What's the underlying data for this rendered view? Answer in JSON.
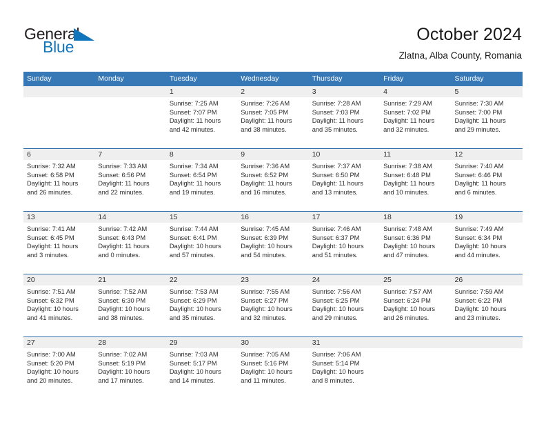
{
  "brand": {
    "name_part1": "General",
    "name_part2": "Blue",
    "triangle_icon": "blue-triangle-icon",
    "color_dark": "#231f20",
    "color_blue": "#1175bc"
  },
  "header": {
    "title": "October 2024",
    "subtitle": "Zlatna, Alba County, Romania"
  },
  "theme": {
    "header_bg": "#3778b7",
    "row_divider": "#2b6cab",
    "date_band_bg": "#efefef",
    "text": "#2b2b2b"
  },
  "weekdays": [
    "Sunday",
    "Monday",
    "Tuesday",
    "Wednesday",
    "Thursday",
    "Friday",
    "Saturday"
  ],
  "labels": {
    "sunrise_prefix": "Sunrise: ",
    "sunset_prefix": "Sunset: ",
    "daylight_prefix": "Daylight: "
  },
  "weeks": [
    {
      "days": [
        {
          "day": "",
          "empty": true
        },
        {
          "day": "",
          "empty": true
        },
        {
          "day": "1",
          "sunrise": "Sunrise: 7:25 AM",
          "sunset": "Sunset: 7:07 PM",
          "daylight1": "Daylight: 11 hours",
          "daylight2": "and 42 minutes."
        },
        {
          "day": "2",
          "sunrise": "Sunrise: 7:26 AM",
          "sunset": "Sunset: 7:05 PM",
          "daylight1": "Daylight: 11 hours",
          "daylight2": "and 38 minutes."
        },
        {
          "day": "3",
          "sunrise": "Sunrise: 7:28 AM",
          "sunset": "Sunset: 7:03 PM",
          "daylight1": "Daylight: 11 hours",
          "daylight2": "and 35 minutes."
        },
        {
          "day": "4",
          "sunrise": "Sunrise: 7:29 AM",
          "sunset": "Sunset: 7:02 PM",
          "daylight1": "Daylight: 11 hours",
          "daylight2": "and 32 minutes."
        },
        {
          "day": "5",
          "sunrise": "Sunrise: 7:30 AM",
          "sunset": "Sunset: 7:00 PM",
          "daylight1": "Daylight: 11 hours",
          "daylight2": "and 29 minutes."
        }
      ]
    },
    {
      "days": [
        {
          "day": "6",
          "sunrise": "Sunrise: 7:32 AM",
          "sunset": "Sunset: 6:58 PM",
          "daylight1": "Daylight: 11 hours",
          "daylight2": "and 26 minutes."
        },
        {
          "day": "7",
          "sunrise": "Sunrise: 7:33 AM",
          "sunset": "Sunset: 6:56 PM",
          "daylight1": "Daylight: 11 hours",
          "daylight2": "and 22 minutes."
        },
        {
          "day": "8",
          "sunrise": "Sunrise: 7:34 AM",
          "sunset": "Sunset: 6:54 PM",
          "daylight1": "Daylight: 11 hours",
          "daylight2": "and 19 minutes."
        },
        {
          "day": "9",
          "sunrise": "Sunrise: 7:36 AM",
          "sunset": "Sunset: 6:52 PM",
          "daylight1": "Daylight: 11 hours",
          "daylight2": "and 16 minutes."
        },
        {
          "day": "10",
          "sunrise": "Sunrise: 7:37 AM",
          "sunset": "Sunset: 6:50 PM",
          "daylight1": "Daylight: 11 hours",
          "daylight2": "and 13 minutes."
        },
        {
          "day": "11",
          "sunrise": "Sunrise: 7:38 AM",
          "sunset": "Sunset: 6:48 PM",
          "daylight1": "Daylight: 11 hours",
          "daylight2": "and 10 minutes."
        },
        {
          "day": "12",
          "sunrise": "Sunrise: 7:40 AM",
          "sunset": "Sunset: 6:46 PM",
          "daylight1": "Daylight: 11 hours",
          "daylight2": "and 6 minutes."
        }
      ]
    },
    {
      "days": [
        {
          "day": "13",
          "sunrise": "Sunrise: 7:41 AM",
          "sunset": "Sunset: 6:45 PM",
          "daylight1": "Daylight: 11 hours",
          "daylight2": "and 3 minutes."
        },
        {
          "day": "14",
          "sunrise": "Sunrise: 7:42 AM",
          "sunset": "Sunset: 6:43 PM",
          "daylight1": "Daylight: 11 hours",
          "daylight2": "and 0 minutes."
        },
        {
          "day": "15",
          "sunrise": "Sunrise: 7:44 AM",
          "sunset": "Sunset: 6:41 PM",
          "daylight1": "Daylight: 10 hours",
          "daylight2": "and 57 minutes."
        },
        {
          "day": "16",
          "sunrise": "Sunrise: 7:45 AM",
          "sunset": "Sunset: 6:39 PM",
          "daylight1": "Daylight: 10 hours",
          "daylight2": "and 54 minutes."
        },
        {
          "day": "17",
          "sunrise": "Sunrise: 7:46 AM",
          "sunset": "Sunset: 6:37 PM",
          "daylight1": "Daylight: 10 hours",
          "daylight2": "and 51 minutes."
        },
        {
          "day": "18",
          "sunrise": "Sunrise: 7:48 AM",
          "sunset": "Sunset: 6:36 PM",
          "daylight1": "Daylight: 10 hours",
          "daylight2": "and 47 minutes."
        },
        {
          "day": "19",
          "sunrise": "Sunrise: 7:49 AM",
          "sunset": "Sunset: 6:34 PM",
          "daylight1": "Daylight: 10 hours",
          "daylight2": "and 44 minutes."
        }
      ]
    },
    {
      "days": [
        {
          "day": "20",
          "sunrise": "Sunrise: 7:51 AM",
          "sunset": "Sunset: 6:32 PM",
          "daylight1": "Daylight: 10 hours",
          "daylight2": "and 41 minutes."
        },
        {
          "day": "21",
          "sunrise": "Sunrise: 7:52 AM",
          "sunset": "Sunset: 6:30 PM",
          "daylight1": "Daylight: 10 hours",
          "daylight2": "and 38 minutes."
        },
        {
          "day": "22",
          "sunrise": "Sunrise: 7:53 AM",
          "sunset": "Sunset: 6:29 PM",
          "daylight1": "Daylight: 10 hours",
          "daylight2": "and 35 minutes."
        },
        {
          "day": "23",
          "sunrise": "Sunrise: 7:55 AM",
          "sunset": "Sunset: 6:27 PM",
          "daylight1": "Daylight: 10 hours",
          "daylight2": "and 32 minutes."
        },
        {
          "day": "24",
          "sunrise": "Sunrise: 7:56 AM",
          "sunset": "Sunset: 6:25 PM",
          "daylight1": "Daylight: 10 hours",
          "daylight2": "and 29 minutes."
        },
        {
          "day": "25",
          "sunrise": "Sunrise: 7:57 AM",
          "sunset": "Sunset: 6:24 PM",
          "daylight1": "Daylight: 10 hours",
          "daylight2": "and 26 minutes."
        },
        {
          "day": "26",
          "sunrise": "Sunrise: 7:59 AM",
          "sunset": "Sunset: 6:22 PM",
          "daylight1": "Daylight: 10 hours",
          "daylight2": "and 23 minutes."
        }
      ]
    },
    {
      "days": [
        {
          "day": "27",
          "sunrise": "Sunrise: 7:00 AM",
          "sunset": "Sunset: 5:20 PM",
          "daylight1": "Daylight: 10 hours",
          "daylight2": "and 20 minutes."
        },
        {
          "day": "28",
          "sunrise": "Sunrise: 7:02 AM",
          "sunset": "Sunset: 5:19 PM",
          "daylight1": "Daylight: 10 hours",
          "daylight2": "and 17 minutes."
        },
        {
          "day": "29",
          "sunrise": "Sunrise: 7:03 AM",
          "sunset": "Sunset: 5:17 PM",
          "daylight1": "Daylight: 10 hours",
          "daylight2": "and 14 minutes."
        },
        {
          "day": "30",
          "sunrise": "Sunrise: 7:05 AM",
          "sunset": "Sunset: 5:16 PM",
          "daylight1": "Daylight: 10 hours",
          "daylight2": "and 11 minutes."
        },
        {
          "day": "31",
          "sunrise": "Sunrise: 7:06 AM",
          "sunset": "Sunset: 5:14 PM",
          "daylight1": "Daylight: 10 hours",
          "daylight2": "and 8 minutes."
        },
        {
          "day": "",
          "empty": true
        },
        {
          "day": "",
          "empty": true
        }
      ]
    }
  ]
}
